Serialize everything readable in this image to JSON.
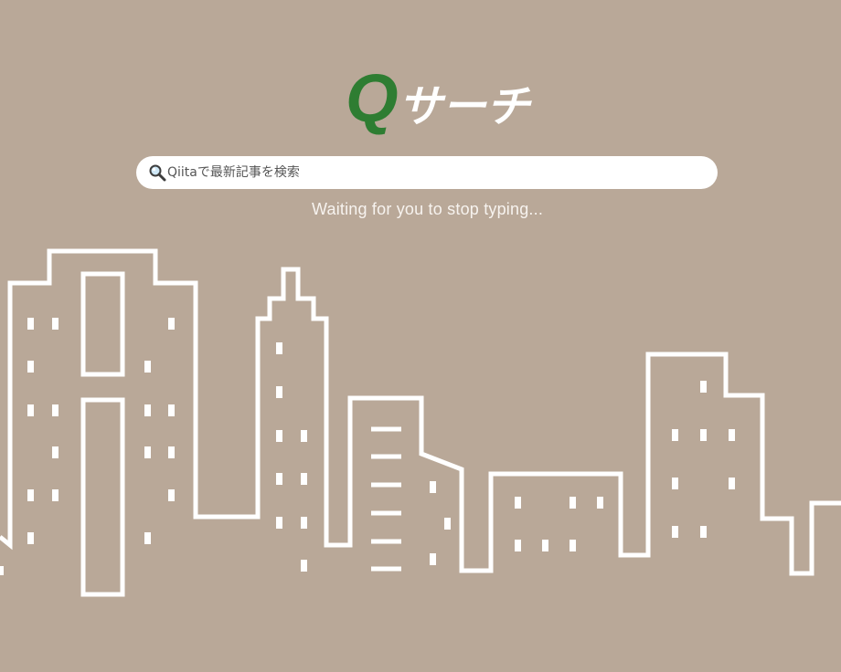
{
  "logo": {
    "q_letter": "Q",
    "rest_text": "サーチ"
  },
  "search": {
    "placeholder": "Qiitaで最新記事を検索",
    "value": "",
    "icon": "magnifier-icon"
  },
  "status": {
    "text": "Waiting for you to stop typing..."
  },
  "colors": {
    "background": "#b9a898",
    "logo_accent": "#2e7d32",
    "skyline_stroke": "#ffffff"
  }
}
